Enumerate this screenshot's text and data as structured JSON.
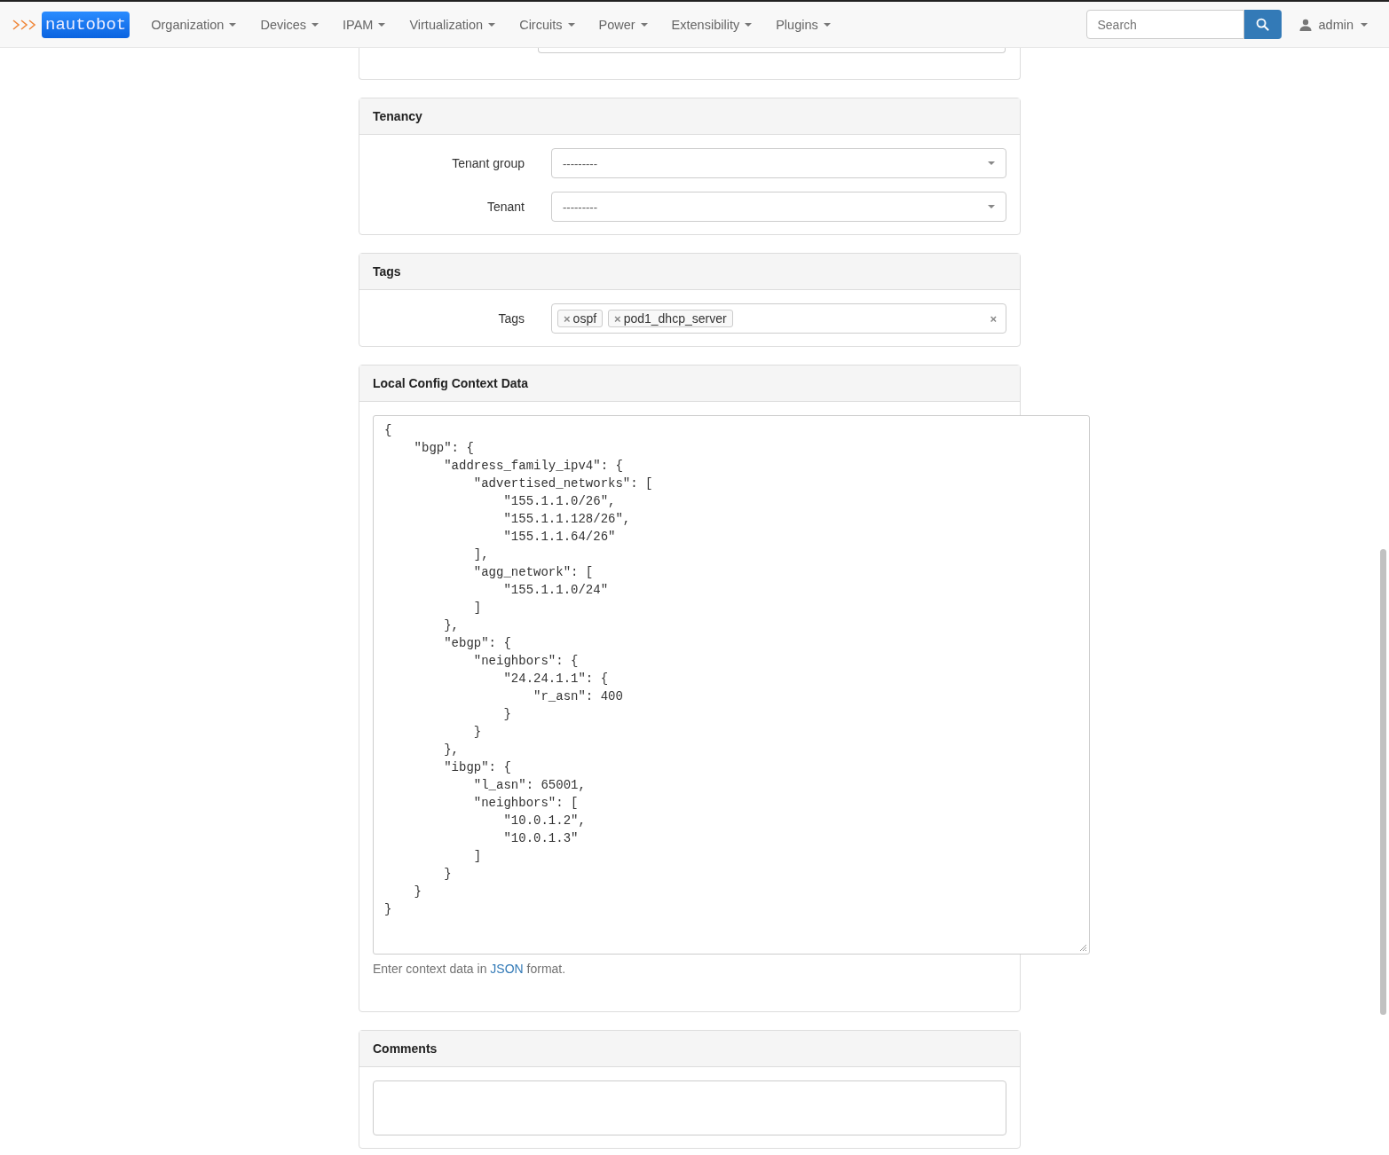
{
  "navbar": {
    "brand": "nautobot",
    "menus": [
      "Organization",
      "Devices",
      "IPAM",
      "Virtualization",
      "Circuits",
      "Power",
      "Extensibility",
      "Plugins"
    ],
    "search": {
      "placeholder": "Search"
    },
    "user": "admin"
  },
  "sections": [
    {
      "kind": "partial"
    },
    {
      "kind": "form",
      "title": "Tenancy",
      "fields": [
        {
          "kind": "select",
          "label": "Tenant group",
          "value": "---------"
        },
        {
          "kind": "select",
          "label": "Tenant",
          "value": "---------"
        }
      ]
    },
    {
      "kind": "form",
      "title": "Tags",
      "fields": [
        {
          "kind": "tags",
          "label": "Tags",
          "tags": [
            "ospf",
            "pod1_dhcp_server"
          ],
          "remove": "×",
          "clear": "×"
        }
      ]
    },
    {
      "kind": "code",
      "title": "Local Config Context Data",
      "value": "{\n    \"bgp\": {\n        \"address_family_ipv4\": {\n            \"advertised_networks\": [\n                \"155.1.1.0/26\",\n                \"155.1.1.128/26\",\n                \"155.1.1.64/26\"\n            ],\n            \"agg_network\": [\n                \"155.1.1.0/24\"\n            ]\n        },\n        \"ebgp\": {\n            \"neighbors\": {\n                \"24.24.1.1\": {\n                    \"r_asn\": 400\n                }\n            }\n        },\n        \"ibgp\": {\n            \"l_asn\": 65001,\n            \"neighbors\": [\n                \"10.0.1.2\",\n                \"10.0.1.3\"\n            ]\n        }\n    }\n}",
      "help": {
        "before": "Enter context data in ",
        "link": "JSON",
        "after": " format."
      }
    },
    {
      "kind": "comments",
      "title": "Comments"
    }
  ]
}
